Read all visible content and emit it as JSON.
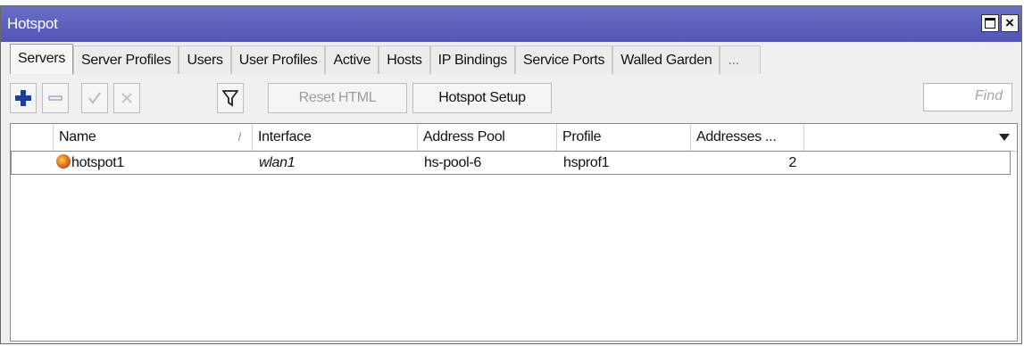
{
  "window": {
    "title": "Hotspot"
  },
  "tabs": [
    {
      "label": "Servers",
      "active": true
    },
    {
      "label": "Server Profiles"
    },
    {
      "label": "Users"
    },
    {
      "label": "User Profiles"
    },
    {
      "label": "Active"
    },
    {
      "label": "Hosts"
    },
    {
      "label": "IP Bindings"
    },
    {
      "label": "Service Ports"
    },
    {
      "label": "Walled Garden"
    },
    {
      "label": "..."
    }
  ],
  "toolbar": {
    "add_icon": "plus-icon",
    "remove_icon": "minus-icon",
    "enable_icon": "check-icon",
    "disable_icon": "x-icon",
    "filter_icon": "filter-icon",
    "reset_html_label": "Reset HTML",
    "hotspot_setup_label": "Hotspot Setup",
    "find_placeholder": "Find"
  },
  "table": {
    "columns": [
      "Name",
      "Interface",
      "Address Pool",
      "Profile",
      "Addresses ..."
    ],
    "sort_indicator": "/",
    "rows": [
      {
        "name": "hotspot1",
        "interface": "wlan1",
        "address_pool": "hs-pool-6",
        "profile": "hsprof1",
        "addresses": "2"
      }
    ]
  },
  "colors": {
    "titlebar": "#5a5fbd",
    "add_icon": "#1c3f9e"
  }
}
